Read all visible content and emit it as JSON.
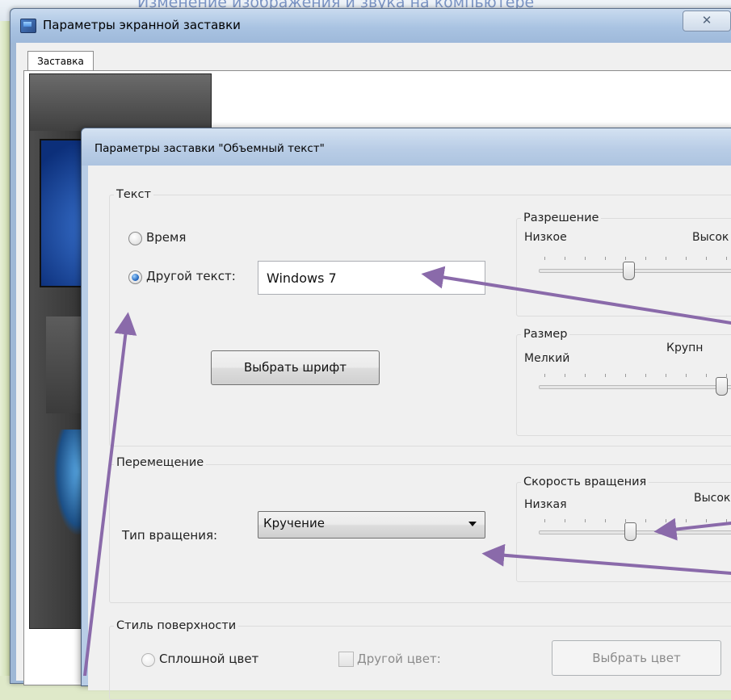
{
  "background": {
    "heading": "Изменение изображения и звука на компьютере"
  },
  "outer_window": {
    "title": "Параметры экранной заставки",
    "close_glyph": "✕",
    "tab_label": "Заставка"
  },
  "dialog": {
    "title": "Параметры заставки \"Объемный текст\"",
    "text_group": {
      "title": "Текст",
      "radio_time": "Время",
      "radio_custom": "Другой текст:",
      "custom_text_value": "Windows 7",
      "choose_font_button": "Выбрать шрифт"
    },
    "resolution": {
      "title": "Разрешение",
      "low": "Низкое",
      "high": "Высок",
      "level": 0.45
    },
    "size": {
      "title": "Размер",
      "low": "Мелкий",
      "high": "Крупн",
      "level": 0.97
    },
    "motion_group": {
      "title": "Перемещение",
      "rotation_type_label": "Тип вращения:",
      "rotation_type_value": "Кручение"
    },
    "rotation_speed": {
      "title": "Скорость вращения",
      "low": "Низкая",
      "high": "Высок",
      "level": 0.46
    },
    "surface_group": {
      "title": "Стиль поверхности",
      "radio_solid": "Сплошной цвет",
      "checkbox_other_color": "Другой цвет:",
      "choose_color_button": "Выбрать цвет"
    }
  },
  "colors": {
    "annotation_arrow": "#8a6aaa",
    "desktop_bg": "#dfe9c9",
    "title_bar": "#b9cde6"
  }
}
